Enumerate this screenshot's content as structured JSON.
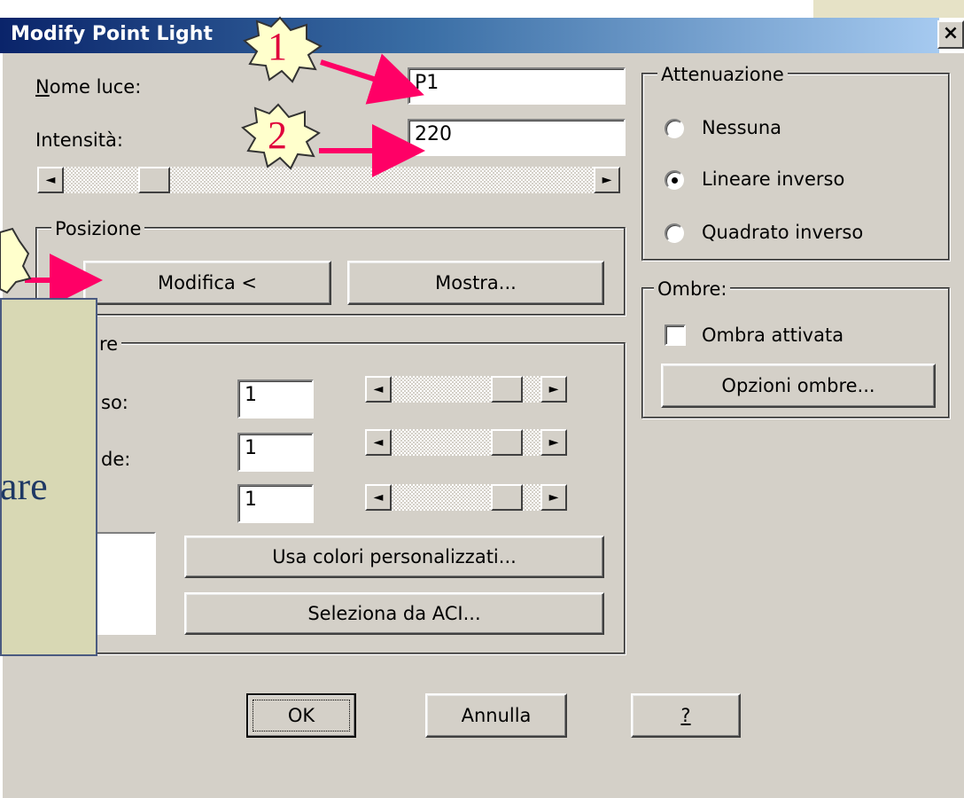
{
  "window": {
    "title": "Modify Point Light",
    "close_label": "×"
  },
  "fields": {
    "nome_luce": {
      "label": "Nome luce:",
      "value": "P1"
    },
    "intensita": {
      "label": "Intensità:",
      "value": "220"
    }
  },
  "intensity_slider": {
    "left": "◄",
    "right": "►",
    "level": 0.15
  },
  "posizione": {
    "title": "Posizione",
    "modifica_label": "Modifica <",
    "mostra_label": "Mostra..."
  },
  "colore": {
    "title_partial": "re",
    "rows": [
      {
        "label_partial": "so:",
        "value": "1",
        "left": "◄",
        "right": "►",
        "level": 0.85
      },
      {
        "label_partial": "de:",
        "value": "1",
        "left": "◄",
        "right": "►",
        "level": 0.85
      },
      {
        "label_partial": "",
        "value": "1",
        "left": "◄",
        "right": "►",
        "level": 0.85
      }
    ],
    "usa_colori_label": "Usa colori personalizzati...",
    "seleziona_label": "Seleziona da ACI..."
  },
  "attenuazione": {
    "title": "Attenuazione",
    "options": [
      {
        "label": "Nessuna",
        "selected": false
      },
      {
        "label": "Lineare inverso",
        "selected": true
      },
      {
        "label": "Quadrato inverso",
        "selected": false
      }
    ]
  },
  "ombre": {
    "title": "Ombre:",
    "checkbox_label": "Ombra attivata",
    "checked": false,
    "opzioni_label": "Opzioni ombre..."
  },
  "footer": {
    "ok_label": "OK",
    "annulla_label": "Annulla",
    "help_label": "?"
  },
  "annotations": {
    "marker_1": "1",
    "marker_2": "2",
    "callout_text": "are",
    "colors": {
      "arrow": "#ff0066",
      "marker_fill": "#ffffcc",
      "callout_bg": "#d8d8b4",
      "callout_text": "#1f3864"
    }
  }
}
